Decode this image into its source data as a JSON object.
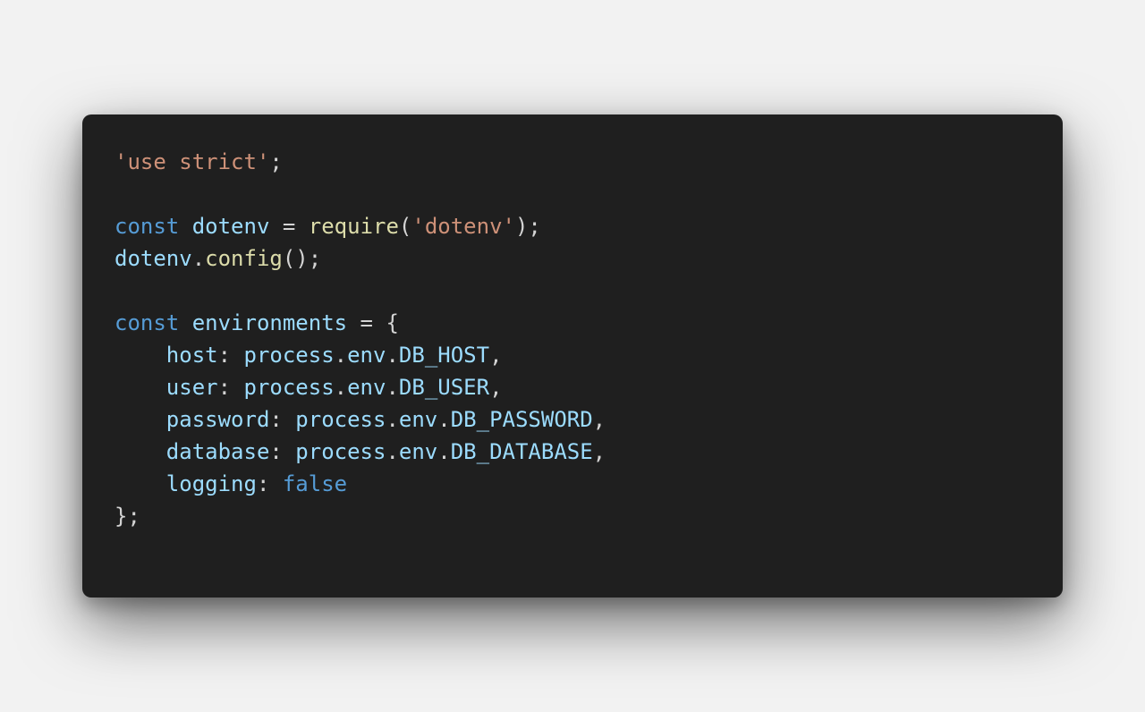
{
  "colors": {
    "page_background": "#f2f2f2",
    "card_background": "#1f1f1f",
    "string": "#ce9178",
    "keyword": "#569cd6",
    "variable": "#9cdcfe",
    "function": "#dcdcaa",
    "punctuation": "#d4d4d4"
  },
  "code": {
    "language": "javascript",
    "lines": [
      [
        {
          "t": "string",
          "v": "'use strict'"
        },
        {
          "t": "punc",
          "v": ";"
        }
      ],
      [],
      [
        {
          "t": "keyword",
          "v": "const"
        },
        {
          "t": "punc",
          "v": " "
        },
        {
          "t": "var",
          "v": "dotenv"
        },
        {
          "t": "punc",
          "v": " = "
        },
        {
          "t": "fn",
          "v": "require"
        },
        {
          "t": "punc",
          "v": "("
        },
        {
          "t": "string",
          "v": "'dotenv'"
        },
        {
          "t": "punc",
          "v": ");"
        }
      ],
      [
        {
          "t": "var",
          "v": "dotenv"
        },
        {
          "t": "punc",
          "v": "."
        },
        {
          "t": "fn",
          "v": "config"
        },
        {
          "t": "punc",
          "v": "();"
        }
      ],
      [],
      [
        {
          "t": "keyword",
          "v": "const"
        },
        {
          "t": "punc",
          "v": " "
        },
        {
          "t": "var",
          "v": "environments"
        },
        {
          "t": "punc",
          "v": " = {"
        }
      ],
      [
        {
          "t": "punc",
          "v": "    "
        },
        {
          "t": "var",
          "v": "host"
        },
        {
          "t": "punc",
          "v": ": "
        },
        {
          "t": "var",
          "v": "process"
        },
        {
          "t": "punc",
          "v": "."
        },
        {
          "t": "var",
          "v": "env"
        },
        {
          "t": "punc",
          "v": "."
        },
        {
          "t": "const",
          "v": "DB_HOST"
        },
        {
          "t": "punc",
          "v": ","
        }
      ],
      [
        {
          "t": "punc",
          "v": "    "
        },
        {
          "t": "var",
          "v": "user"
        },
        {
          "t": "punc",
          "v": ": "
        },
        {
          "t": "var",
          "v": "process"
        },
        {
          "t": "punc",
          "v": "."
        },
        {
          "t": "var",
          "v": "env"
        },
        {
          "t": "punc",
          "v": "."
        },
        {
          "t": "const",
          "v": "DB_USER"
        },
        {
          "t": "punc",
          "v": ","
        }
      ],
      [
        {
          "t": "punc",
          "v": "    "
        },
        {
          "t": "var",
          "v": "password"
        },
        {
          "t": "punc",
          "v": ": "
        },
        {
          "t": "var",
          "v": "process"
        },
        {
          "t": "punc",
          "v": "."
        },
        {
          "t": "var",
          "v": "env"
        },
        {
          "t": "punc",
          "v": "."
        },
        {
          "t": "const",
          "v": "DB_PASSWORD"
        },
        {
          "t": "punc",
          "v": ","
        }
      ],
      [
        {
          "t": "punc",
          "v": "    "
        },
        {
          "t": "var",
          "v": "database"
        },
        {
          "t": "punc",
          "v": ": "
        },
        {
          "t": "var",
          "v": "process"
        },
        {
          "t": "punc",
          "v": "."
        },
        {
          "t": "var",
          "v": "env"
        },
        {
          "t": "punc",
          "v": "."
        },
        {
          "t": "const",
          "v": "DB_DATABASE"
        },
        {
          "t": "punc",
          "v": ","
        }
      ],
      [
        {
          "t": "punc",
          "v": "    "
        },
        {
          "t": "var",
          "v": "logging"
        },
        {
          "t": "punc",
          "v": ": "
        },
        {
          "t": "bool",
          "v": "false"
        }
      ],
      [
        {
          "t": "punc",
          "v": "};"
        }
      ]
    ]
  }
}
